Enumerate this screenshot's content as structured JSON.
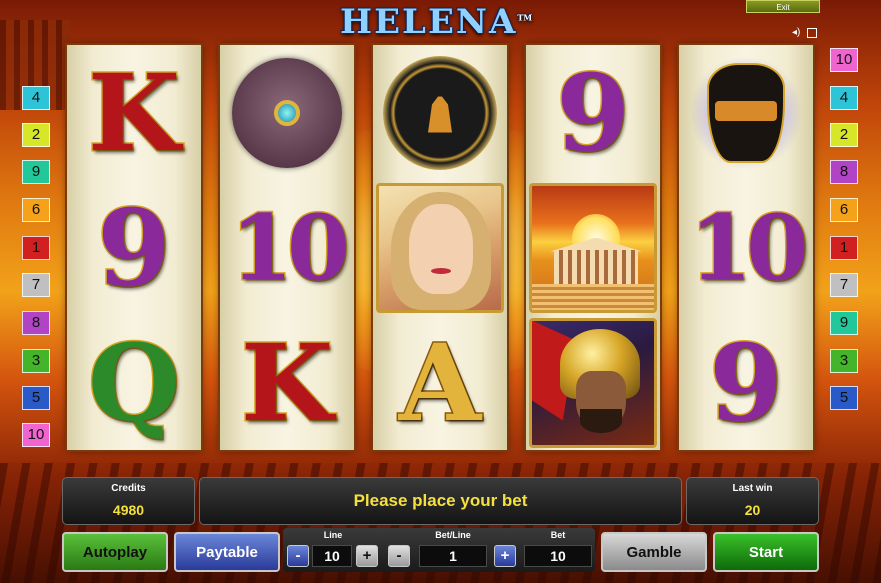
{
  "game": {
    "title": "HELENA",
    "trademark": "TM"
  },
  "top": {
    "exit_label": "Exit",
    "sound_icon": "speaker-icon",
    "fullscreen_icon": "fullscreen-icon"
  },
  "reels": [
    {
      "symbols": [
        "K",
        "9",
        "Q"
      ]
    },
    {
      "symbols": [
        "bracelet",
        "10",
        "K"
      ]
    },
    {
      "symbols": [
        "plate",
        "helena",
        "A"
      ]
    },
    {
      "symbols": [
        "9",
        "temple",
        "warrior"
      ]
    },
    {
      "symbols": [
        "amphora",
        "10",
        "9"
      ]
    }
  ],
  "paylines": {
    "left": [
      "4",
      "2",
      "9",
      "6",
      "1",
      "7",
      "8",
      "3",
      "5",
      "10"
    ],
    "right": [
      "10",
      "4",
      "2",
      "8",
      "6",
      "1",
      "7",
      "9",
      "3",
      "5"
    ]
  },
  "panels": {
    "credits_label": "Credits",
    "credits_value": "4980",
    "message": "Please place your bet",
    "lastwin_label": "Last win",
    "lastwin_value": "20"
  },
  "controls": {
    "autoplay": "Autoplay",
    "paytable": "Paytable",
    "line_label": "Line",
    "line_value": "10",
    "betline_label": "Bet/Line",
    "betline_value": "1",
    "bet_label": "Bet",
    "bet_value": "10",
    "minus": "-",
    "plus": "+",
    "gamble": "Gamble",
    "start": "Start"
  },
  "colors": {
    "accent_yellow": "#f4e040",
    "panel_dark": "#141414"
  }
}
